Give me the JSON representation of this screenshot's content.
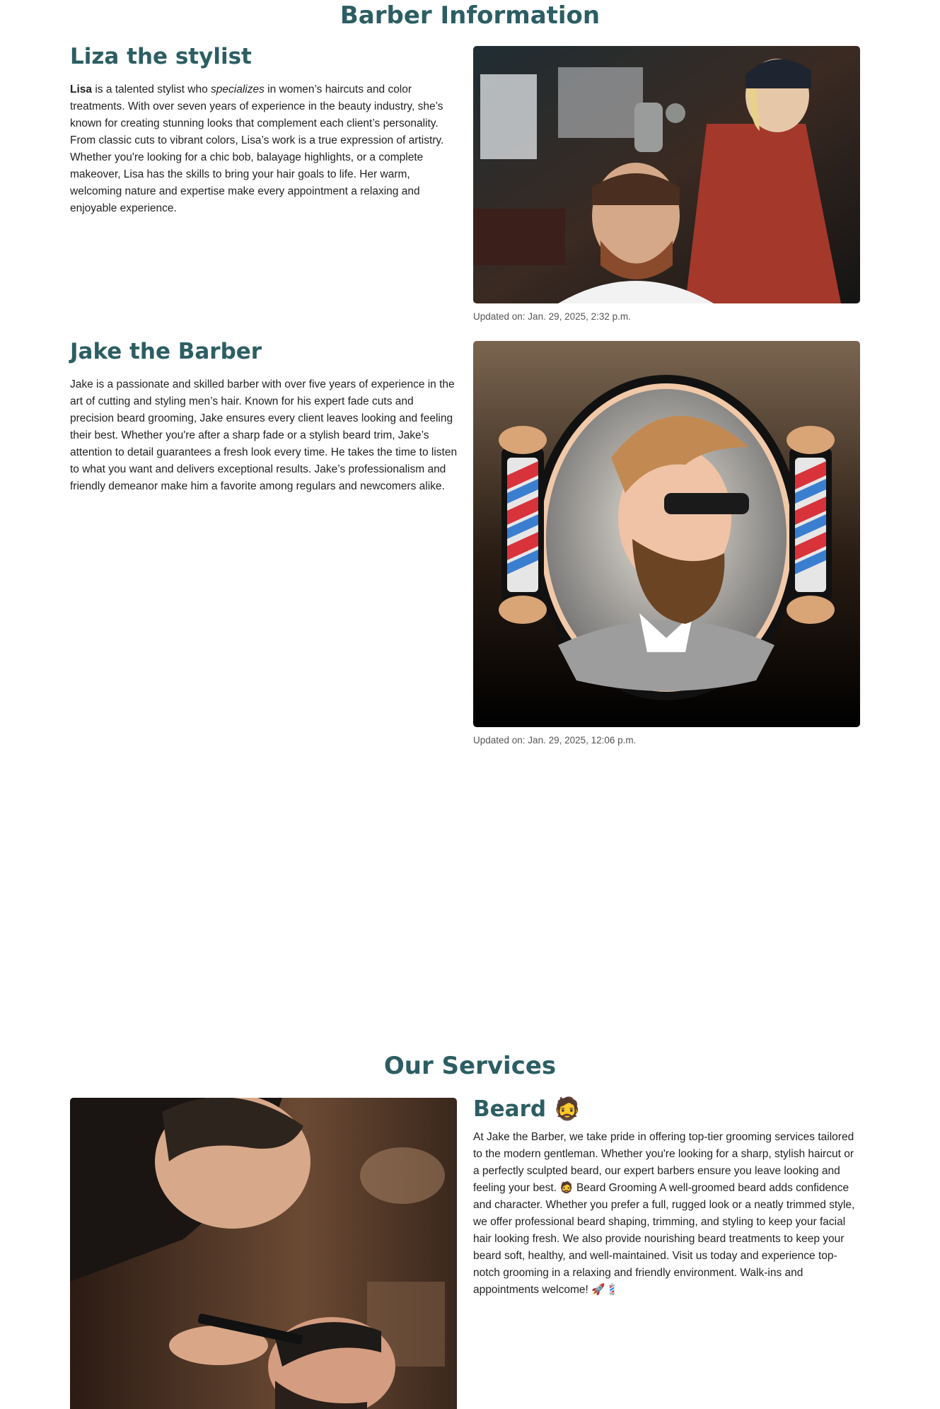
{
  "barber_section": {
    "title": "Barber Information",
    "barbers": [
      {
        "name": "Liza the stylist",
        "bio_lead": "Lisa",
        "bio_part1": " is a talented stylist who ",
        "bio_emphasis": "specializes",
        "bio_part2": " in women’s haircuts and color treatments. With over seven years of experience in the beauty industry, she’s known for creating stunning looks that complement each client’s personality. From classic cuts to vibrant colors, Lisa’s work is a true expression of artistry. Whether you're looking for a chic bob, balayage highlights, or a complete makeover, Lisa has the skills to bring your hair goals to life. Her warm, welcoming nature and expertise make every appointment a relaxing and enjoyable experience.",
        "updated": "Updated on: Jan. 29, 2025, 2:32 p.m.",
        "photo_alt": "stylist-at-work-photo"
      },
      {
        "name": "Jake the Barber",
        "bio": "Jake is a passionate and skilled barber with over five years of experience in the art of cutting and styling men’s hair. Known for his expert fade cuts and precision beard grooming, Jake ensures every client leaves looking and feeling their best. Whether you're after a sharp fade or a stylish beard trim, Jake’s attention to detail guarantees a fresh look every time. He takes the time to listen to what you want and delivers exceptional results. Jake’s professionalism and friendly demeanor make him a favorite among regulars and newcomers alike.",
        "updated": "Updated on: Jan. 29, 2025, 12:06 p.m.",
        "photo_alt": "barber-logo-illustration"
      }
    ]
  },
  "services_section": {
    "title": "Our Services",
    "services": [
      {
        "name": "Beard 🧔",
        "description": "At Jake the Barber, we take pride in offering top-tier grooming services tailored to the modern gentleman. Whether you're looking for a sharp, stylish haircut or a perfectly sculpted beard, our expert barbers ensure you leave looking and feeling your best. 🧔 Beard Grooming A well-groomed beard adds confidence and character. Whether you prefer a full, rugged look or a neatly trimmed style, we offer professional beard shaping, trimming, and styling to keep your facial hair looking fresh. We also provide nourishing beard treatments to keep your beard soft, healthy, and well-maintained. Visit us today and experience top-notch grooming in a relaxing and friendly environment. Walk-ins and appointments welcome! 🚀💈",
        "photo_alt": "beard-trim-photo"
      }
    ]
  },
  "colors": {
    "heading": "#2c5e63",
    "body_text": "#222222",
    "muted_text": "#555555"
  }
}
